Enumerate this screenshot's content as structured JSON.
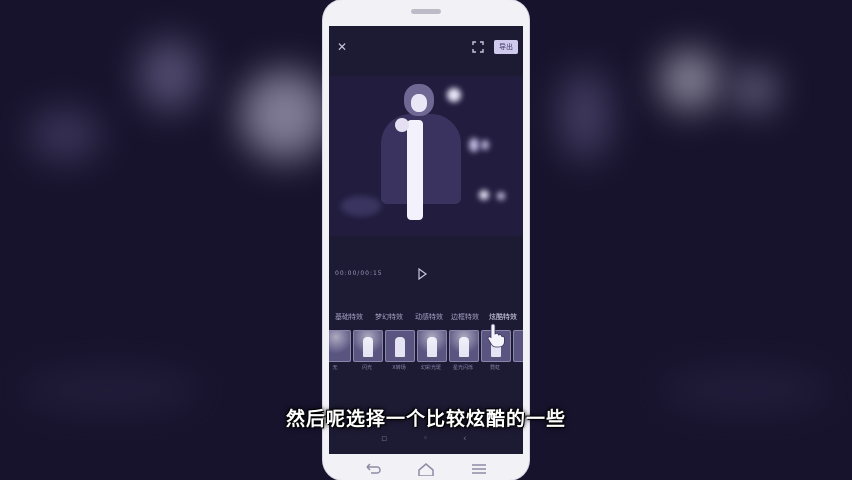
{
  "video": {
    "subtitle": "然后呢选择一个比较炫酷的一些"
  },
  "editor": {
    "export_label": "导出",
    "timecode": "00:00/00:15",
    "tabs": [
      {
        "label": "基础特效",
        "active": false
      },
      {
        "label": "梦幻特效",
        "active": false
      },
      {
        "label": "动感特效",
        "active": false
      },
      {
        "label": "边框特效",
        "active": false
      },
      {
        "label": "炫酷特效",
        "active": true
      }
    ],
    "thumbnails": [
      {
        "label": "无"
      },
      {
        "label": "闪光"
      },
      {
        "label": "X转场"
      },
      {
        "label": "幻彩光斑"
      },
      {
        "label": "星光闪烁"
      },
      {
        "label": "霓虹"
      }
    ]
  },
  "colors": {
    "accent": "#cfc9ec",
    "screen_bg": "#1d1a33",
    "subtitle": "#ffffff"
  },
  "icons": [
    "close-icon",
    "expand-icon",
    "play-icon",
    "hand-pointer-icon",
    "back-icon",
    "home-icon",
    "menu-icon"
  ]
}
